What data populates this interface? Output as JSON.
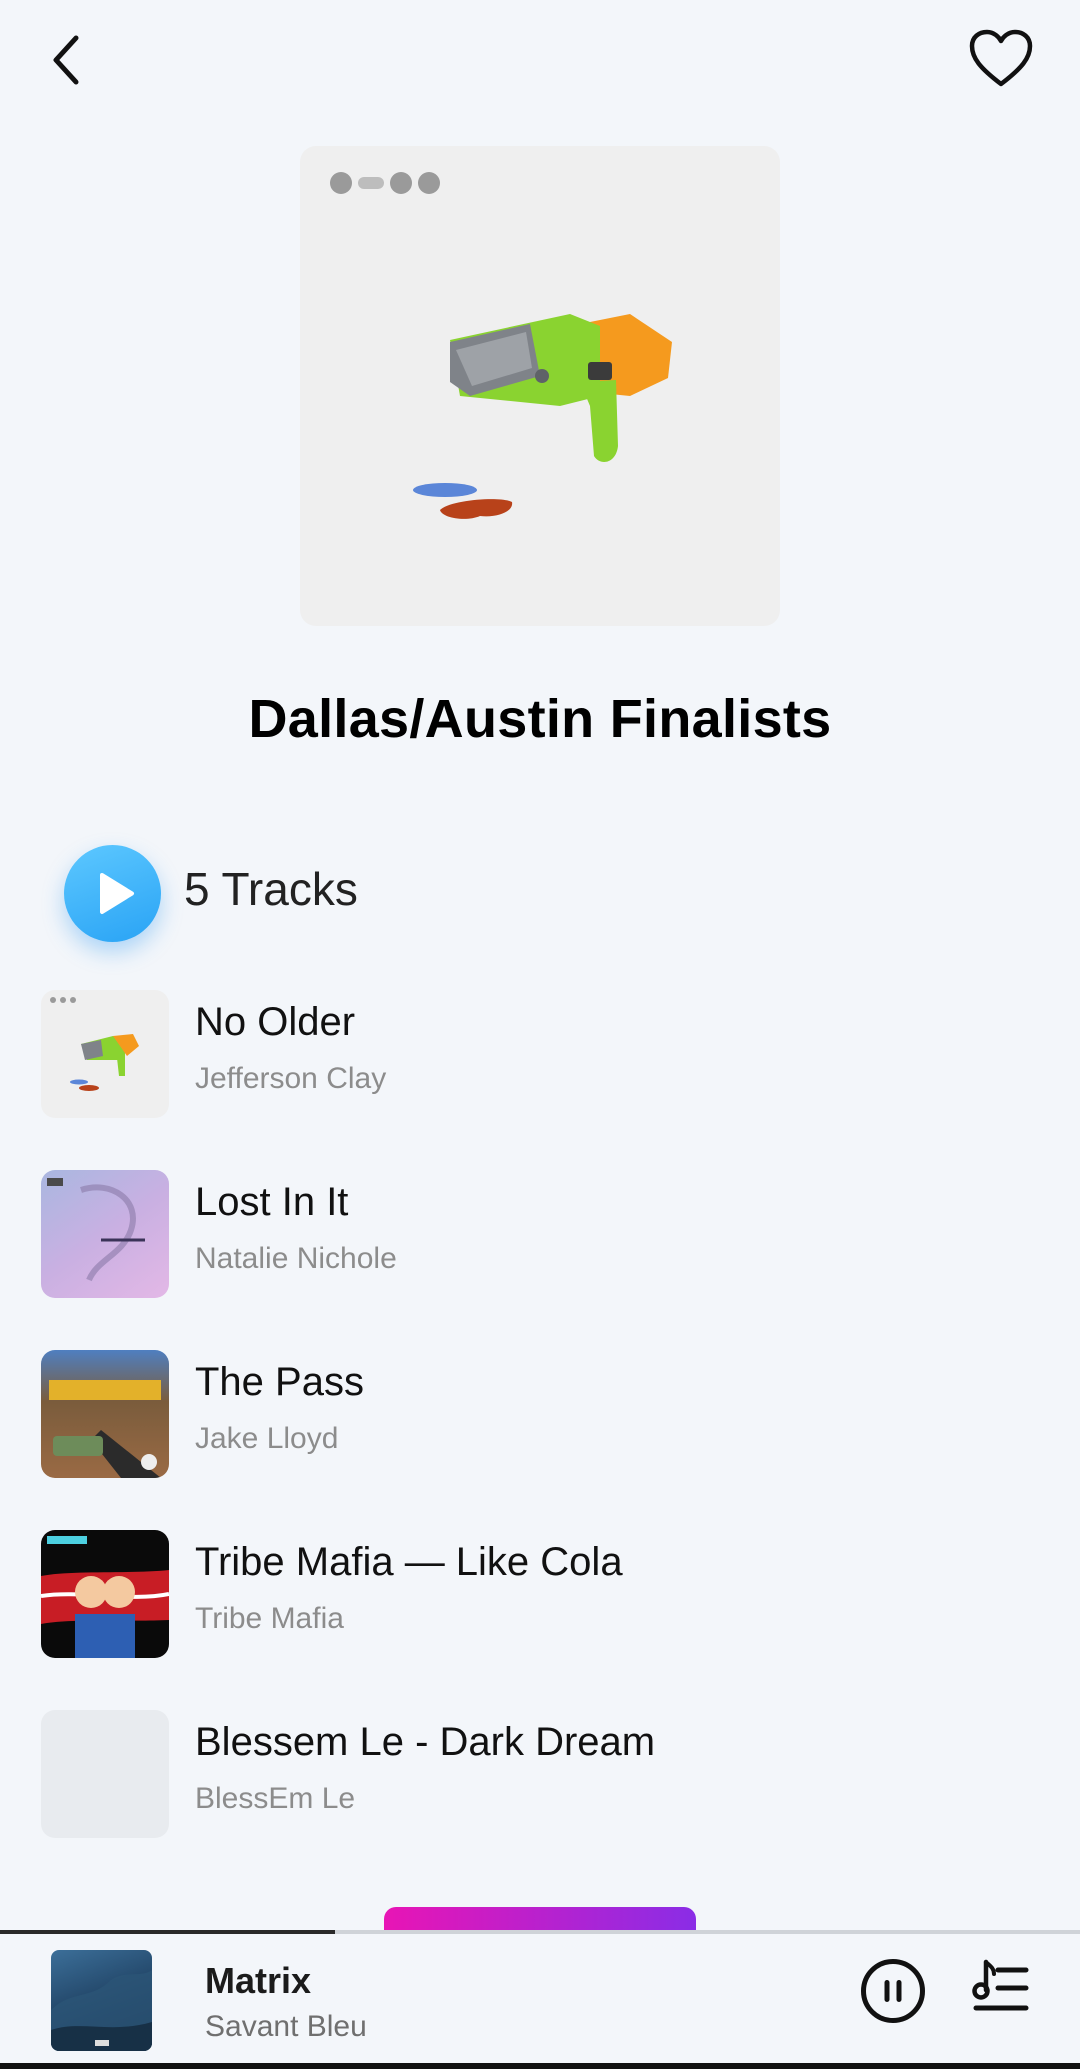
{
  "header": {
    "back_icon": "chevron-left-icon",
    "favorite_icon": "heart-outline-icon"
  },
  "playlist": {
    "title": "Dallas/Austin Finalists",
    "track_count_label": "5 Tracks"
  },
  "tracks": [
    {
      "title": "No Older",
      "artist": "Jefferson Clay"
    },
    {
      "title": "Lost In It",
      "artist": "Natalie Nichole"
    },
    {
      "title": "The Pass",
      "artist": "Jake Lloyd"
    },
    {
      "title": "Tribe Mafia — Like Cola",
      "artist": "Tribe Mafia"
    },
    {
      "title": "Blessem Le - Dark Dream",
      "artist": "BlessEm Le"
    }
  ],
  "now_playing": {
    "title": "Matrix",
    "artist": "Savant Bleu",
    "progress": 0.31
  },
  "colors": {
    "accent_play": "#33aef7",
    "bottom_pill_start": "#e815b5",
    "bottom_pill_end": "#8a2de6",
    "background": "#f3f6fa"
  }
}
